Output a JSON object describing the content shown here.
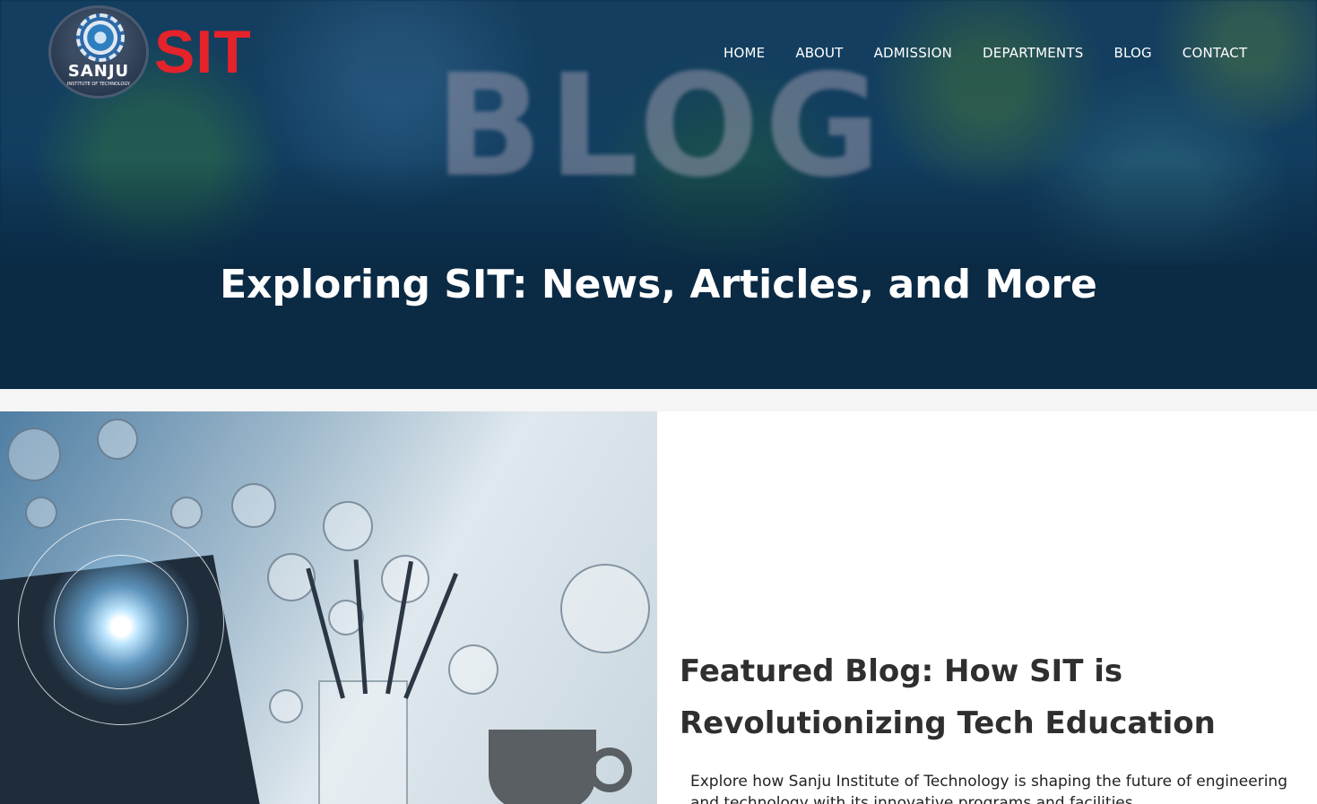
{
  "site": {
    "logo_name": "SANJU",
    "logo_subtitle": "INSTITUTE OF TECHNOLOGY",
    "logo_text": "SIT",
    "brand_color": "#e4232b"
  },
  "nav": {
    "items": [
      {
        "label": "HOME"
      },
      {
        "label": "ABOUT"
      },
      {
        "label": "ADMISSION"
      },
      {
        "label": "DEPARTMENTS"
      },
      {
        "label": "BLOG"
      },
      {
        "label": "CONTACT"
      }
    ]
  },
  "hero": {
    "background_word": "BLOG",
    "title": "Exploring SIT: News, Articles, and More",
    "overlay_color": "#0b2a44"
  },
  "featured": {
    "title": "Featured Blog: How SIT is Revolutionizing Tech Education",
    "excerpt": "Explore how Sanju Institute of Technology is shaping the future of engineering and technology with its innovative programs and facilities."
  }
}
